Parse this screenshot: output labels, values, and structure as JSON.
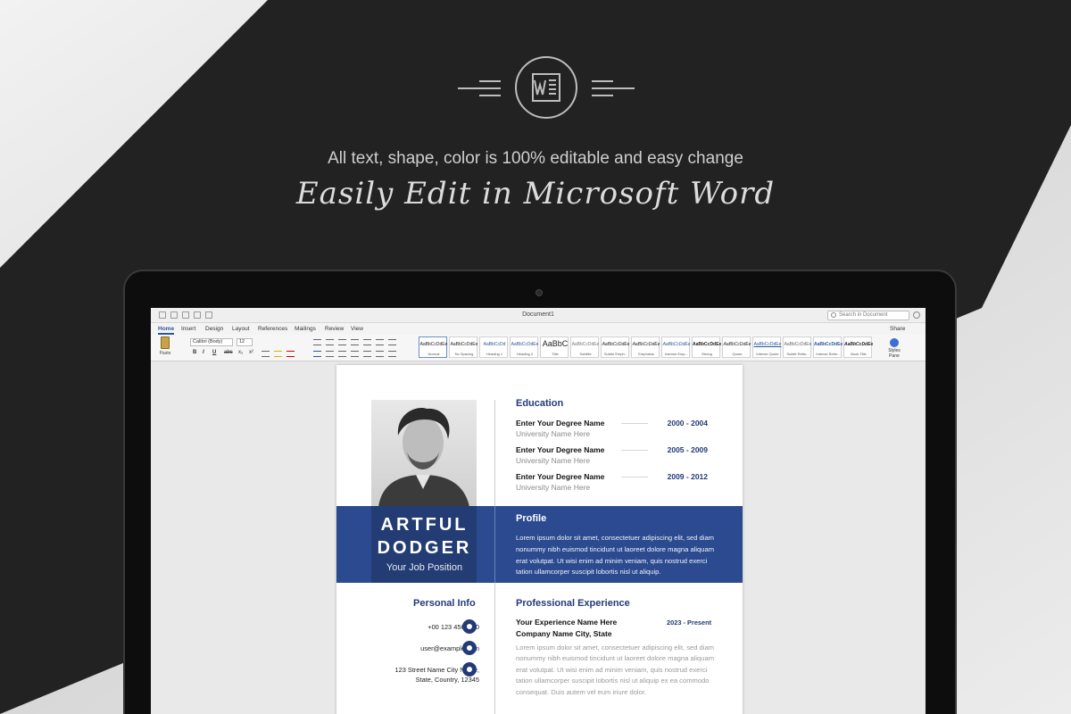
{
  "hero": {
    "app_icon": "word-icon",
    "tagline": "All text, shape, color is 100% editable and easy change",
    "headline": "Easily Edit in Microsoft Word"
  },
  "word": {
    "window_title": "Document1",
    "search_placeholder": "Search in Document",
    "tabs": [
      {
        "label": "Home",
        "active": true
      },
      {
        "label": "Insert"
      },
      {
        "label": "Design"
      },
      {
        "label": "Layout"
      },
      {
        "label": "References"
      },
      {
        "label": "Mailings"
      },
      {
        "label": "Review"
      },
      {
        "label": "View"
      }
    ],
    "share_label": "Share",
    "ribbon": {
      "paste_label": "Paste",
      "font_name": "Calibri (Body)",
      "font_size": "12",
      "format_buttons": [
        "B",
        "I",
        "U",
        "abc",
        "x₂",
        "x²"
      ],
      "styles": [
        {
          "sample": "AaBbCcDdEe",
          "name": "Normal",
          "active": true
        },
        {
          "sample": "AaBbCcDdEe",
          "name": "No Spacing"
        },
        {
          "sample": "AaBbCcDd",
          "name": "Heading 1"
        },
        {
          "sample": "AaBbCcDdEe",
          "name": "Heading 2"
        },
        {
          "sample": "AaBbC",
          "name": "Title",
          "big": true
        },
        {
          "sample": "AaBbCcDdEe",
          "name": "Subtitle"
        },
        {
          "sample": "AaBbCcDdEe",
          "name": "Subtle Emph..."
        },
        {
          "sample": "AaBbCcDdEe",
          "name": "Emphasis"
        },
        {
          "sample": "AaBbCcDdEe",
          "name": "Intense Emp..."
        },
        {
          "sample": "AaBbCcDdEe",
          "name": "Strong"
        },
        {
          "sample": "AaBbCcDdEe",
          "name": "Quote"
        },
        {
          "sample": "AaBbCcDdEe",
          "name": "Intense Quote"
        },
        {
          "sample": "AaBbCcDdEe",
          "name": "Subtle Refer..."
        },
        {
          "sample": "AaBbCcDdEe",
          "name": "Intense Refer..."
        },
        {
          "sample": "AaBbCcDdEe",
          "name": "Book Title"
        }
      ],
      "styles_pane_label": "Styles Pane"
    }
  },
  "resume": {
    "name_line1": "ARTFUL",
    "name_line2": "DODGER",
    "job_position": "Your Job Position",
    "education": {
      "heading": "Education",
      "items": [
        {
          "degree": "Enter Your Degree Name",
          "university": "University Name Here",
          "years": "2000 - 2004"
        },
        {
          "degree": "Enter Your Degree Name",
          "university": "University Name Here",
          "years": "2005 - 2009"
        },
        {
          "degree": "Enter Your Degree Name",
          "university": "University Name Here",
          "years": "2009 - 2012"
        }
      ]
    },
    "profile": {
      "heading": "Profile",
      "text": "Lorem ipsum dolor sit amet, consectetuer adipiscing elit, sed diam nonummy nibh euismod tincidunt ut laoreet dolore magna aliquam erat volutpat. Ut wisi enim ad minim veniam, quis nostrud exerci tation ullamcorper suscipit lobortis nisl ut aliquip."
    },
    "personal_info": {
      "heading": "Personal Info",
      "phone": "+00 123 4567890",
      "email": "user@example.com",
      "address_line1": "123 Street Name City Name,",
      "address_line2": "State, Country, 12345"
    },
    "experience": {
      "heading": "Professional Experience",
      "title": "Your Experience Name Here",
      "years": "2023 - Present",
      "company": "Company Name City, State",
      "text": "Lorem ipsum dolor sit amet, consectetuer adipiscing elit, sed diam nonummy nibh euismod tincidunt ut laoreet dolore magna aliquam erat volutpat. Ut wisi enim ad minim veniam, quis nostrud exerci tation ullamcorper suscipit lobortis nisl ut aliquip ex ea commodo consequat. Duis autem vel eum iriure dolor."
    }
  }
}
